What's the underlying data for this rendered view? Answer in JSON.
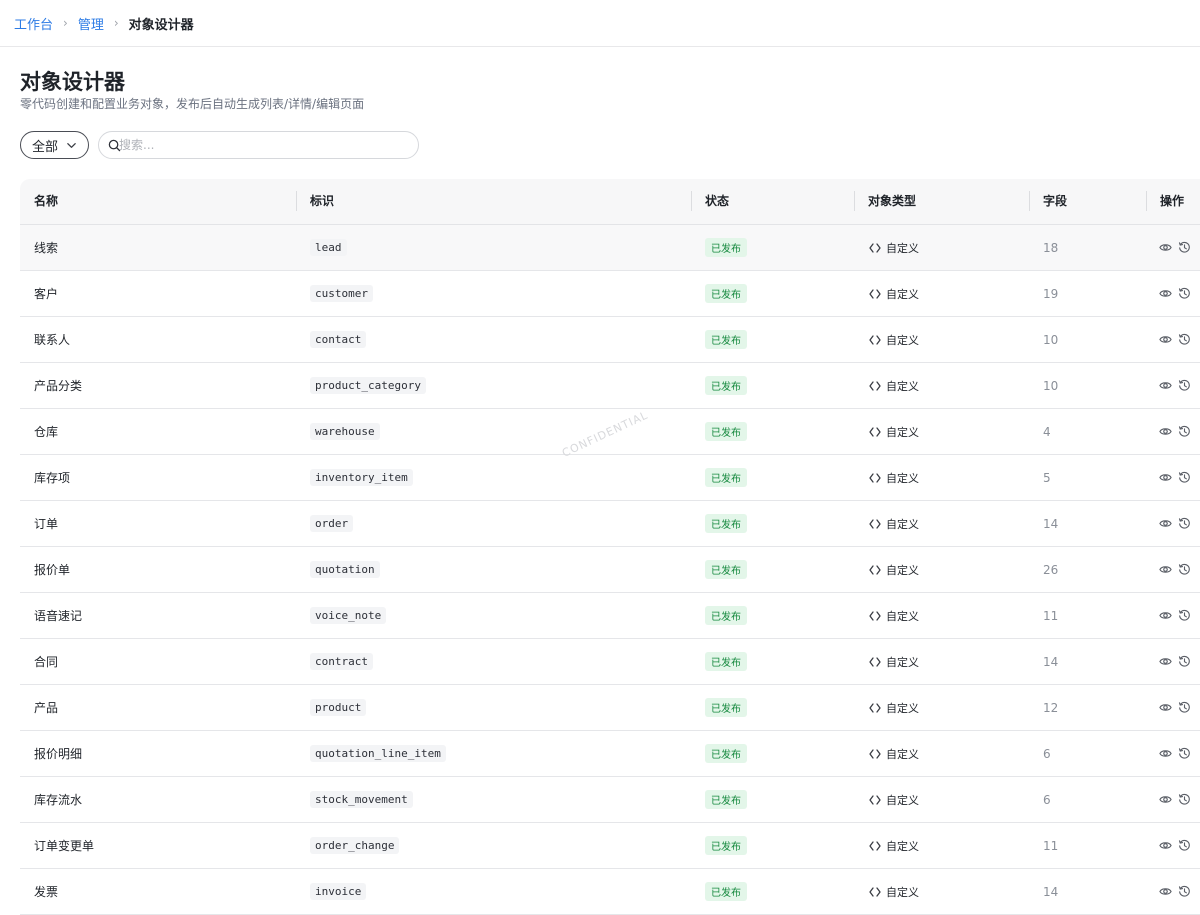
{
  "breadcrumb": {
    "items": [
      {
        "label": "工作台"
      },
      {
        "label": "管理"
      }
    ],
    "current": "对象设计器"
  },
  "page": {
    "title": "对象设计器",
    "subtitle": "零代码创建和配置业务对象，发布后自动生成列表/详情/编辑页面"
  },
  "filter": {
    "selected": "全部"
  },
  "search": {
    "placeholder": "搜索...",
    "value": ""
  },
  "table": {
    "columns": [
      "名称",
      "标识",
      "状态",
      "对象类型",
      "字段",
      "操作"
    ],
    "rows": [
      {
        "name": "线索",
        "key": "lead",
        "status": "已发布",
        "type": "自定义",
        "fields": "18"
      },
      {
        "name": "客户",
        "key": "customer",
        "status": "已发布",
        "type": "自定义",
        "fields": "19"
      },
      {
        "name": "联系人",
        "key": "contact",
        "status": "已发布",
        "type": "自定义",
        "fields": "10"
      },
      {
        "name": "产品分类",
        "key": "product_category",
        "status": "已发布",
        "type": "自定义",
        "fields": "10"
      },
      {
        "name": "仓库",
        "key": "warehouse",
        "status": "已发布",
        "type": "自定义",
        "fields": "4"
      },
      {
        "name": "库存项",
        "key": "inventory_item",
        "status": "已发布",
        "type": "自定义",
        "fields": "5"
      },
      {
        "name": "订单",
        "key": "order",
        "status": "已发布",
        "type": "自定义",
        "fields": "14"
      },
      {
        "name": "报价单",
        "key": "quotation",
        "status": "已发布",
        "type": "自定义",
        "fields": "26"
      },
      {
        "name": "语音速记",
        "key": "voice_note",
        "status": "已发布",
        "type": "自定义",
        "fields": "11"
      },
      {
        "name": "合同",
        "key": "contract",
        "status": "已发布",
        "type": "自定义",
        "fields": "14"
      },
      {
        "name": "产品",
        "key": "product",
        "status": "已发布",
        "type": "自定义",
        "fields": "12"
      },
      {
        "name": "报价明细",
        "key": "quotation_line_item",
        "status": "已发布",
        "type": "自定义",
        "fields": "6"
      },
      {
        "name": "库存流水",
        "key": "stock_movement",
        "status": "已发布",
        "type": "自定义",
        "fields": "6"
      },
      {
        "name": "订单变更单",
        "key": "order_change",
        "status": "已发布",
        "type": "自定义",
        "fields": "11"
      },
      {
        "name": "发票",
        "key": "invoice",
        "status": "已发布",
        "type": "自定义",
        "fields": "14"
      }
    ]
  },
  "watermark": "CONFIDENTIAL",
  "colors": {
    "link": "#2c7be5",
    "published_text": "#16893f",
    "published_bg": "#e3f6e9"
  },
  "icons": {
    "chevron": "chevron-down-icon",
    "search": "search-icon",
    "type": "code-icon",
    "view": "eye-icon",
    "history": "history-icon"
  }
}
